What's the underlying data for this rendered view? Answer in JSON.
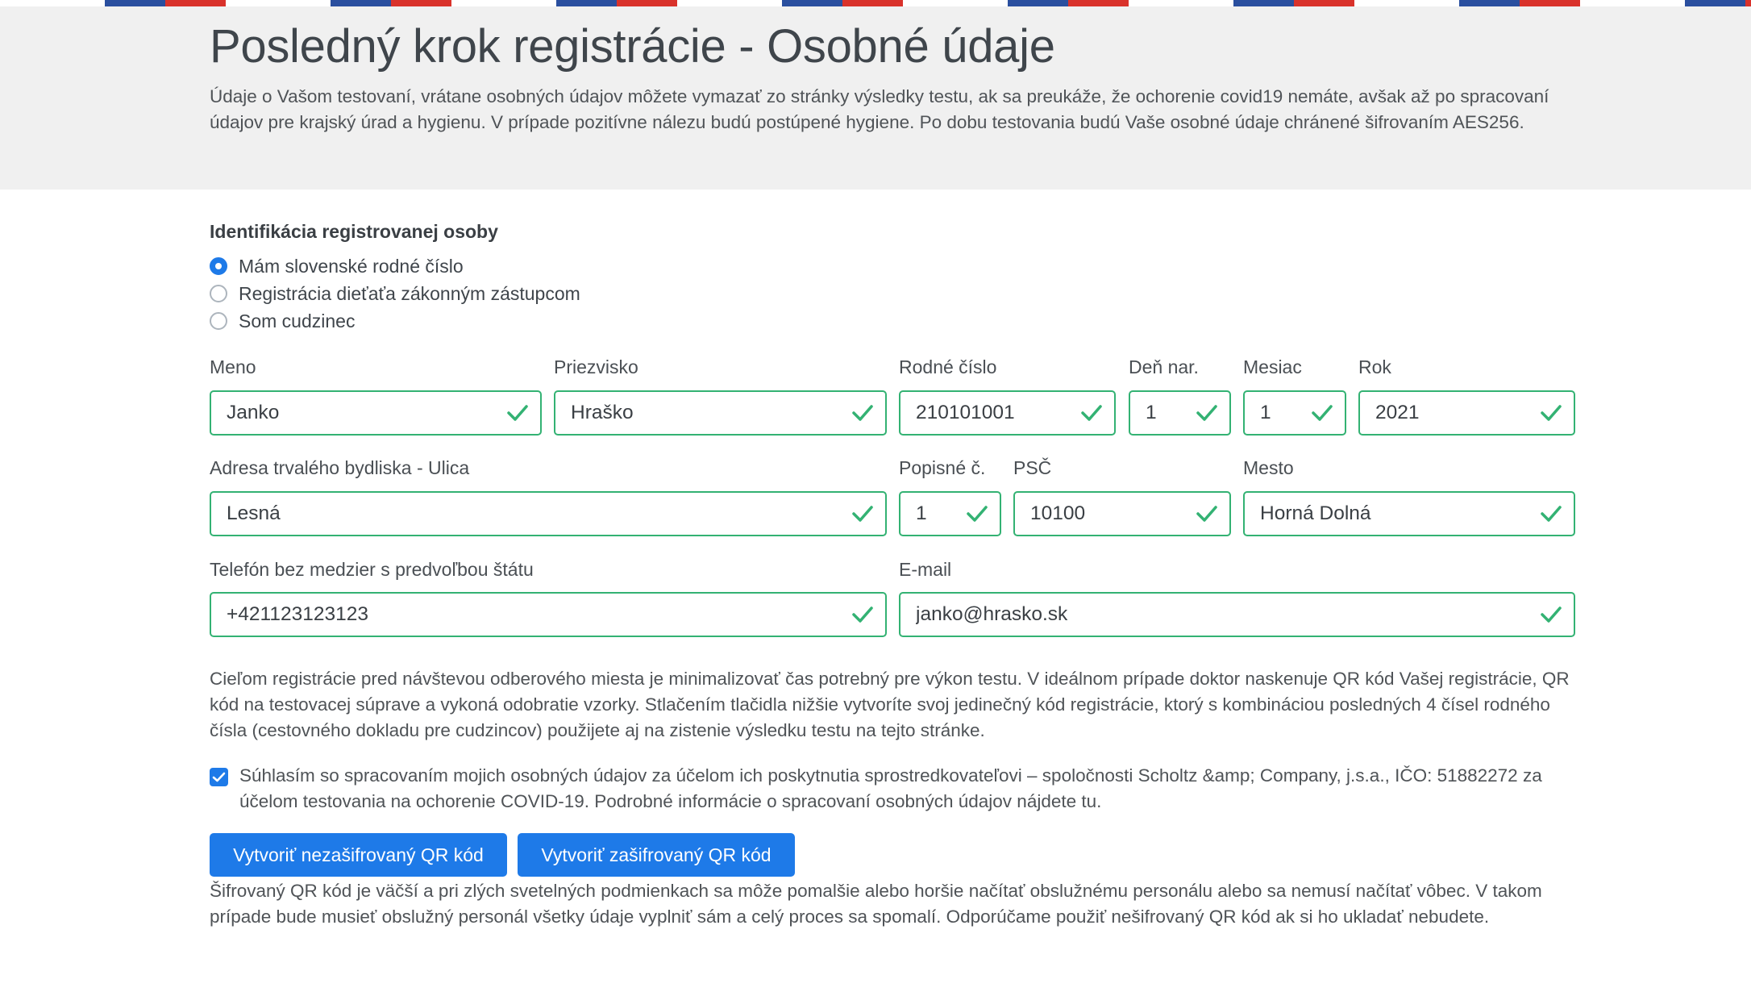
{
  "header": {
    "title": "Posledný krok registrácie - Osobné údaje",
    "lead": "Údaje o Vašom testovaní, vrátane osobných údajov môžete vymazať zo stránky výsledky testu, ak sa preukáže, že ochorenie covid19 nemáte, avšak až po spracovaní údajov pre krajský úrad a hygienu. V prípade pozitívne nálezu budú postúpené hygiene. Po dobu testovania budú Vaše osobné údaje chránené šifrovaním AES256."
  },
  "identification": {
    "title": "Identifikácia registrovanej osoby",
    "options": [
      {
        "label": "Mám slovenské rodné číslo",
        "checked": true
      },
      {
        "label": "Registrácia dieťaťa zákonným zástupcom",
        "checked": false
      },
      {
        "label": "Som cudzinec",
        "checked": false
      }
    ]
  },
  "fields": {
    "meno": {
      "label": "Meno",
      "value": "Janko"
    },
    "priezvisko": {
      "label": "Priezvisko",
      "value": "Hraško"
    },
    "rodne_cislo": {
      "label": "Rodné číslo",
      "value": "210101001"
    },
    "den": {
      "label": "Deň nar.",
      "value": "1"
    },
    "mesiac": {
      "label": "Mesiac",
      "value": "1"
    },
    "rok": {
      "label": "Rok",
      "value": "2021"
    },
    "ulica": {
      "label": "Adresa trvalého bydliska - Ulica",
      "value": "Lesná"
    },
    "popisne": {
      "label": "Popisné č.",
      "value": "1"
    },
    "psc": {
      "label": "PSČ",
      "value": "10100"
    },
    "mesto": {
      "label": "Mesto",
      "value": "Horná Dolná"
    },
    "telefon": {
      "label": "Telefón bez medzier s predvoľbou štátu",
      "value": "+421123123123"
    },
    "email": {
      "label": "E-mail",
      "value": "janko@hrasko.sk"
    }
  },
  "info_text": "Cieľom registrácie pred návštevou odberového miesta je minimalizovať čas potrebný pre výkon testu. V ideálnom prípade doktor naskenuje QR kód Vašej registrácie, QR kód na testovacej súprave a vykoná odobratie vzorky. Stlačením tlačidla nižšie vytvoríte svoj jedinečný kód registrácie, ktorý s kombináciou posledných 4 čísel rodného čísla (cestovného dokladu pre cudzincov) použijete aj na zistenie výsledku testu na tejto stránke.",
  "consent": {
    "checked": true,
    "text": "Súhlasím so spracovaním mojich osobných údajov za účelom ich poskytnutia sprostredkovateľovi – spoločnosti Scholtz &amp; Company, j.s.a., IČO: 51882272 za účelom testovania na ochorenie COVID-19. Podrobné informácie o spracovaní osobných údajov nájdete tu."
  },
  "buttons": {
    "unencrypted": "Vytvoriť nezašifrovaný QR kód",
    "encrypted": "Vytvoriť zašifrovaný QR kód"
  },
  "note_text": "Šifrovaný QR kód je väčší a pri zlých svetelných podmienkach sa môže pomalšie alebo horšie načítať obslužnému personálu alebo sa nemusí načítať vôbec. V takom prípade bude musieť obslužný personál všetky údaje vyplniť sám a celý proces sa spomalí. Odporúčame použiť nešifrovaný QR kód ak si ho ukladať nebudete.",
  "colors": {
    "accent": "#1e7ae8",
    "valid_border": "#33b273",
    "hero_bg": "#f0f0f0"
  },
  "icons": {
    "field_valid": "check-icon",
    "consent": "checkbox-check-icon"
  }
}
